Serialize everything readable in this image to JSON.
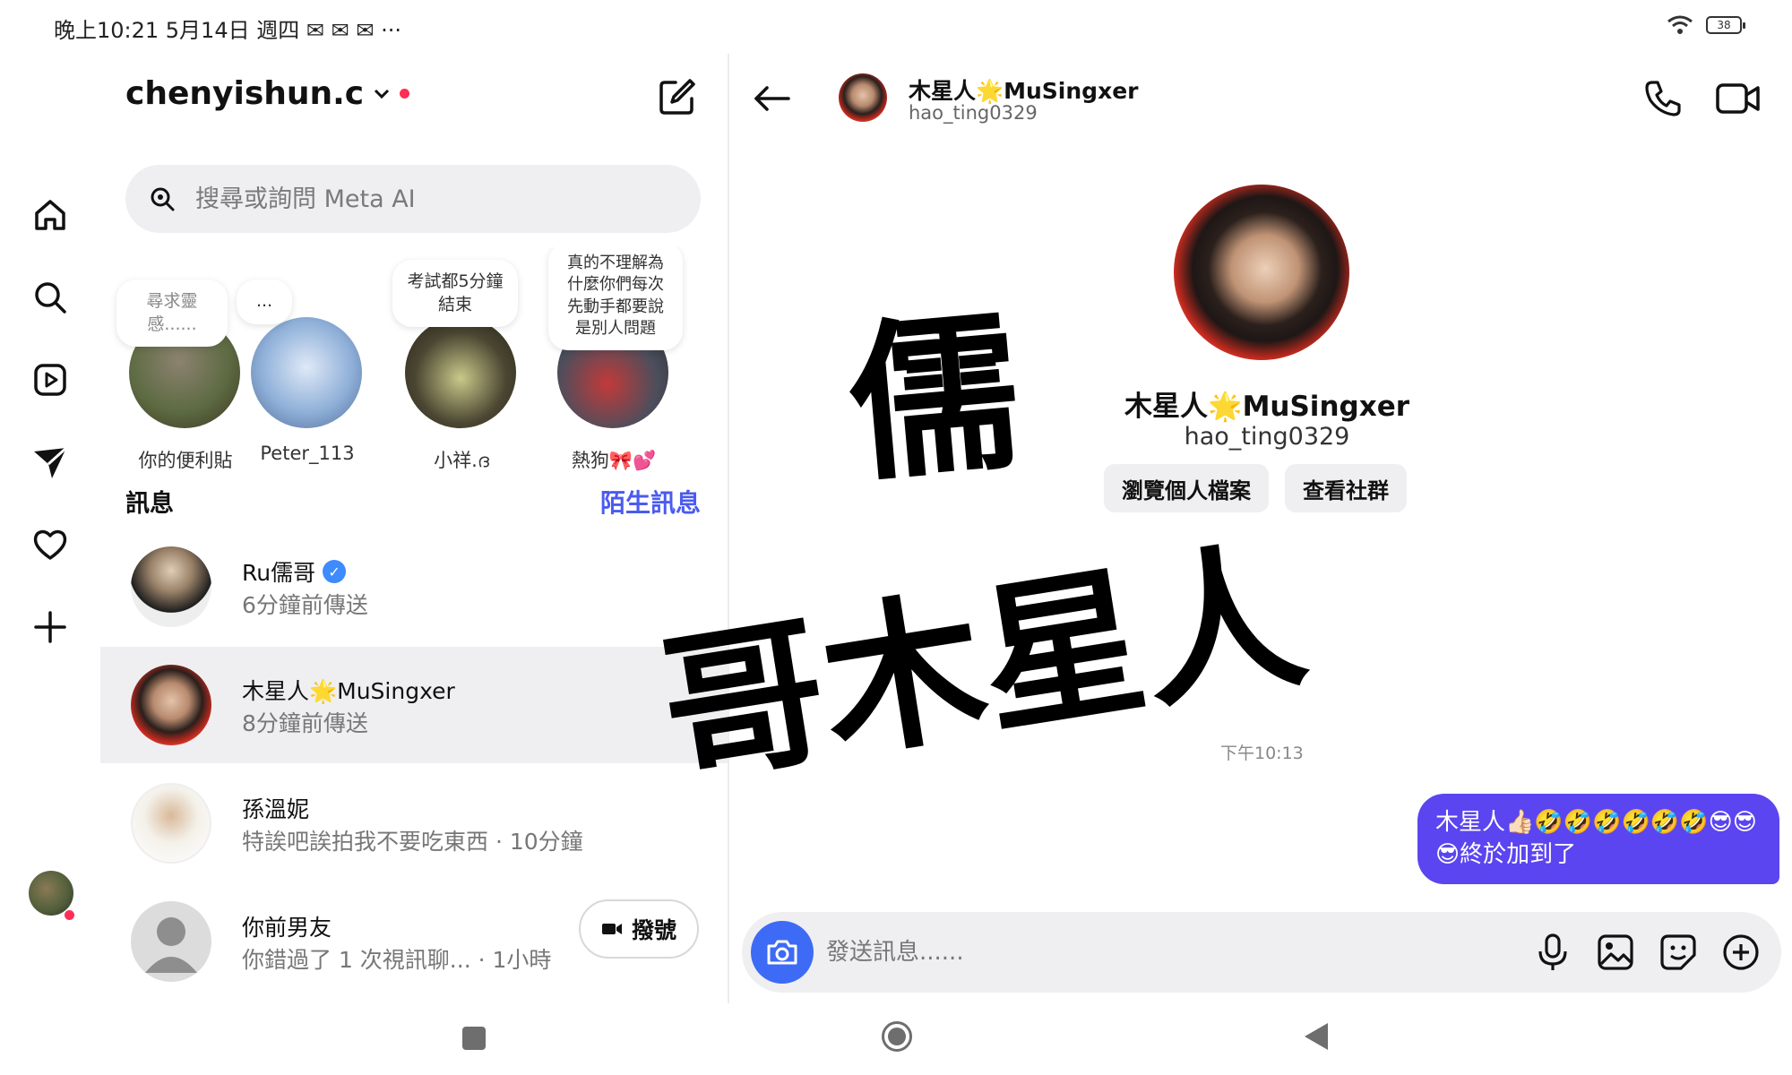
{
  "status_bar": {
    "time": "晚上10:21 5月14日 週四 ✉ ✉ ✉ ···",
    "battery": "38"
  },
  "sidebar": {
    "items": [
      {
        "icon": "home-icon"
      },
      {
        "icon": "search-icon"
      },
      {
        "icon": "reels-icon"
      },
      {
        "icon": "direct-messages-icon"
      },
      {
        "icon": "heart-icon"
      },
      {
        "icon": "plus-icon"
      }
    ]
  },
  "inbox": {
    "account": "chenyishun.c",
    "search_placeholder": "搜尋或詢問 Meta AI",
    "notes": [
      {
        "bubble": "尋求靈感......",
        "name": "你的便利貼"
      },
      {
        "bubble": "...",
        "name": "Peter_113"
      },
      {
        "bubble": "考試都5分鐘結束",
        "name": "小祥.ദ"
      },
      {
        "bubble": "真的不理解為什麼你們每次先動手都要說是別人問題",
        "name": "熱狗🎀💕"
      }
    ],
    "section_title": "訊息",
    "section_link": "陌生訊息",
    "chats": [
      {
        "name": "Ru儒哥",
        "subtitle": "6分鐘前傳送",
        "verified": true
      },
      {
        "name": "木星人🌟MuSingxer",
        "subtitle": "8分鐘前傳送"
      },
      {
        "name": "孫溫妮",
        "subtitle": "特誒吧誒拍我不要吃東西 · 10分鐘"
      },
      {
        "name": "你前男友",
        "subtitle": "你錯過了 1 次視訊聊... · 1小時",
        "action": "撥號"
      }
    ]
  },
  "thread": {
    "header": {
      "name": "木星人🌟MuSingxer",
      "handle": "hao_ting0329"
    },
    "profile": {
      "name": "木星人🌟MuSingxer",
      "handle": "hao_ting0329",
      "buttons": [
        "瀏覽個人檔案",
        "查看社群"
      ]
    },
    "timestamp": "下午10:13",
    "outgoing_message": "木星人👍🏻🤣🤣🤣🤣🤣🤣😎😎😎終於加到了",
    "composer_placeholder": "發送訊息......"
  },
  "overlay": {
    "line1": "儒",
    "line2": "哥木星人"
  },
  "colors": {
    "accent": "#5b45f0",
    "link": "#4a5bf0",
    "camera": "#3d6bf6",
    "alert": "#ff2d55"
  }
}
